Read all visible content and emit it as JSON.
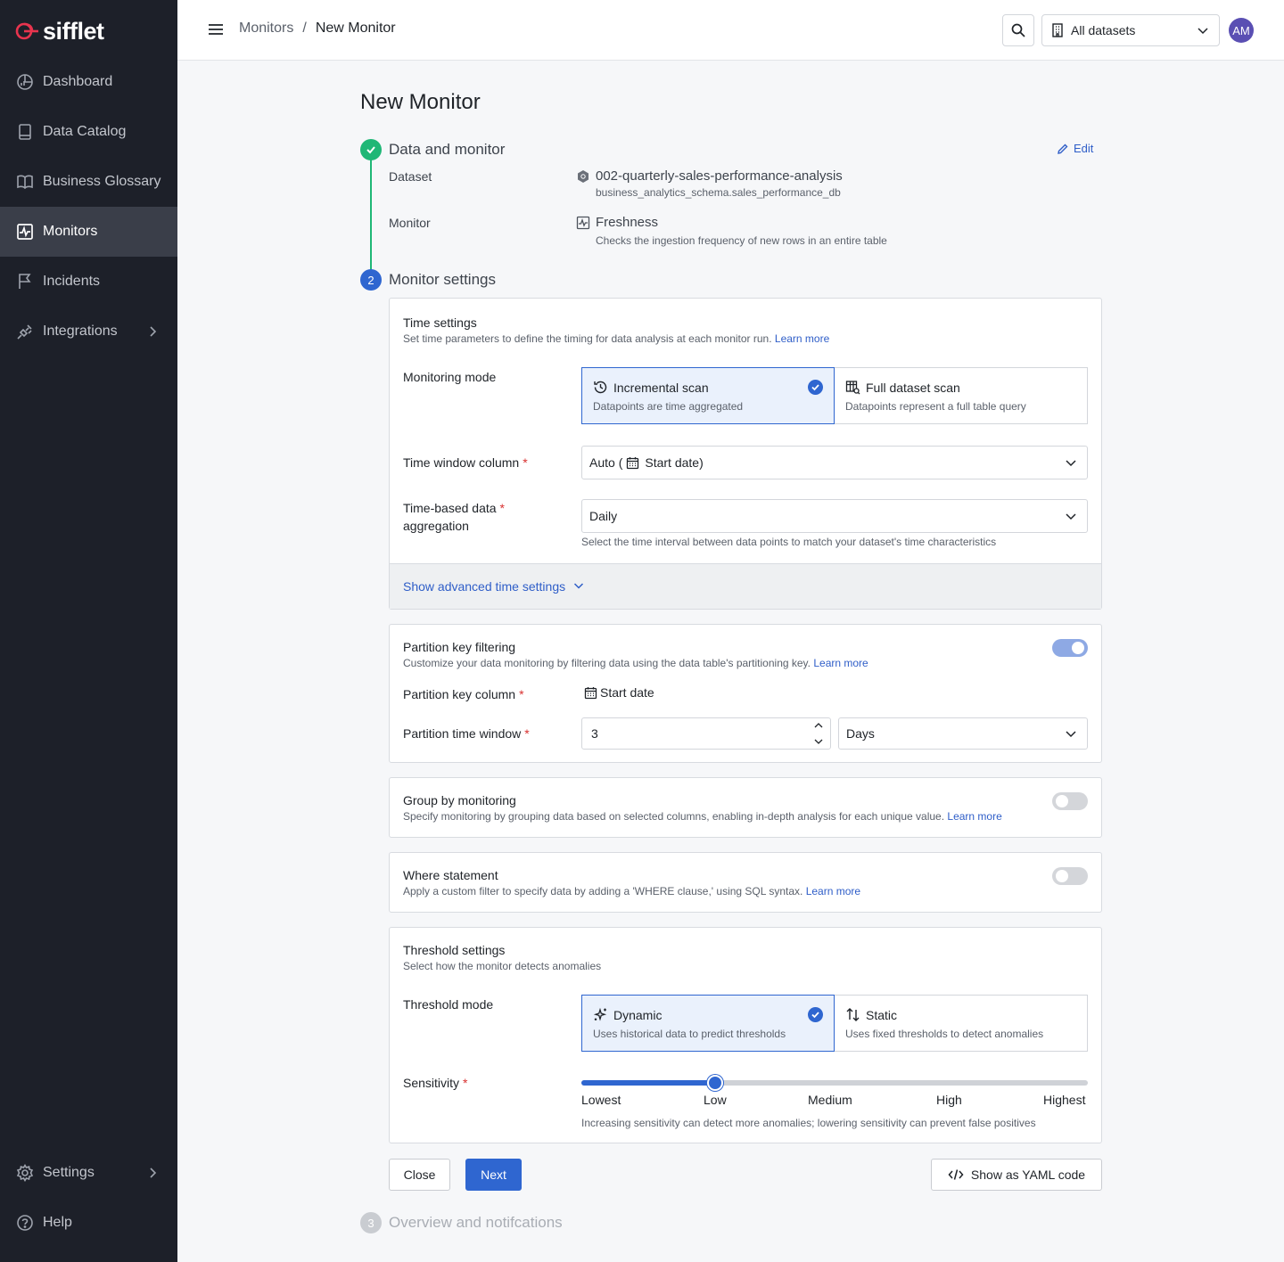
{
  "app": {
    "brand": "sifflet"
  },
  "sidebar": {
    "items": [
      {
        "label": "Dashboard",
        "icon": "dashboard-icon"
      },
      {
        "label": "Data Catalog",
        "icon": "catalog-icon"
      },
      {
        "label": "Business Glossary",
        "icon": "book-icon"
      },
      {
        "label": "Monitors",
        "icon": "monitor-icon",
        "active": true
      },
      {
        "label": "Incidents",
        "icon": "flag-icon"
      },
      {
        "label": "Integrations",
        "icon": "plug-icon"
      }
    ],
    "bottom_items": [
      {
        "label": "Settings",
        "icon": "gear-icon"
      },
      {
        "label": "Help",
        "icon": "help-icon"
      }
    ]
  },
  "header": {
    "breadcrumb": [
      "Monitors",
      "New Monitor"
    ],
    "breadcrumb_separator": "/",
    "dataset_filter": "All datasets",
    "avatar_initials": "AM"
  },
  "page": {
    "title": "New Monitor"
  },
  "steps": {
    "step1": {
      "title": "Data and monitor",
      "edit_label": "Edit",
      "dataset_label": "Dataset",
      "dataset_name": "002-quarterly-sales-performance-analysis",
      "dataset_path": "business_analytics_schema.sales_performance_db",
      "monitor_label": "Monitor",
      "monitor_name": "Freshness",
      "monitor_desc": "Checks the ingestion frequency of new rows in an entire table"
    },
    "step2": {
      "number": "2",
      "title": "Monitor settings"
    },
    "step3": {
      "number": "3",
      "title": "Overview and notifcations"
    }
  },
  "time_settings": {
    "title": "Time settings",
    "desc": "Set time parameters to define the timing for data analysis at each monitor run.",
    "learn_more": "Learn more",
    "monitoring_mode_label": "Monitoring mode",
    "modes": [
      {
        "title": "Incremental scan",
        "sub": "Datapoints are time aggregated",
        "selected": true
      },
      {
        "title": "Full dataset scan",
        "sub": "Datapoints represent a full table query",
        "selected": false
      }
    ],
    "time_window_label": "Time window column",
    "time_window_value_prefix": "Auto (",
    "time_window_value": "Start date)",
    "aggregation_label_1": "Time-based data",
    "aggregation_label_2": "aggregation",
    "aggregation_value": "Daily",
    "aggregation_help": "Select the time interval between data points to match your dataset's time characteristics",
    "advanced_label": "Show advanced time settings"
  },
  "partition": {
    "title": "Partition key filtering",
    "desc": "Customize your data monitoring by filtering data using the data table's partitioning key.",
    "learn_more": "Learn more",
    "enabled": true,
    "key_column_label": "Partition key column",
    "key_column_value": "Start date",
    "time_window_label": "Partition time window",
    "time_window_value": "3",
    "time_window_unit": "Days"
  },
  "group_by": {
    "title": "Group by monitoring",
    "desc": "Specify monitoring by grouping data based on selected columns, enabling in-depth analysis for each unique value.",
    "learn_more": "Learn more",
    "enabled": false
  },
  "where": {
    "title": "Where statement",
    "desc": "Apply a custom filter to specify data by adding a 'WHERE clause,' using SQL syntax.",
    "learn_more": "Learn more",
    "enabled": false
  },
  "threshold": {
    "title": "Threshold settings",
    "desc": "Select how the monitor detects anomalies",
    "mode_label": "Threshold mode",
    "modes": [
      {
        "title": "Dynamic",
        "sub": "Uses historical data to predict thresholds",
        "selected": true
      },
      {
        "title": "Static",
        "sub": "Uses fixed thresholds to detect anomalies",
        "selected": false
      }
    ],
    "sensitivity_label": "Sensitivity",
    "sensitivity_levels": [
      "Lowest",
      "Low",
      "Medium",
      "High",
      "Highest"
    ],
    "sensitivity_value": "Low",
    "sensitivity_help": "Increasing sensitivity can detect more anomalies; lowering sensitivity can prevent false positives"
  },
  "actions": {
    "close_label": "Close",
    "next_label": "Next",
    "yaml_label": "Show as YAML code"
  },
  "colors": {
    "accent": "#2f66d0",
    "success": "#1fb776",
    "sidebar_bg": "#1d2029",
    "brand_red": "#e8344e"
  }
}
